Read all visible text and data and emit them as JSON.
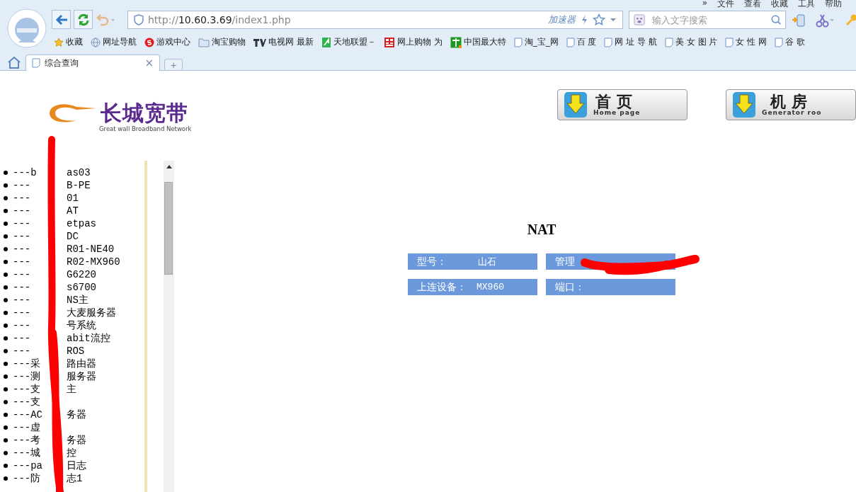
{
  "browser": {
    "menu": [
      "»",
      "文件",
      "查看",
      "收藏",
      "工具",
      "帮助"
    ],
    "url": {
      "scheme": "http://",
      "host": "10.60.3.69",
      "path": "/index1.php"
    },
    "accelerator": "加速器",
    "search": {
      "placeholder": "输入文字搜索"
    },
    "bookmarks": [
      {
        "label": "收藏",
        "kind": "star"
      },
      {
        "label": "网址导航",
        "kind": "globe"
      },
      {
        "label": "游戏中心",
        "kind": "game"
      },
      {
        "label": "淘宝购物",
        "kind": "folder"
      },
      {
        "label": "电视网 最新",
        "kind": "tv"
      },
      {
        "label": "天地联盟－",
        "kind": "green"
      },
      {
        "label": "网上购物 为",
        "kind": "red"
      },
      {
        "label": "中国最大特",
        "kind": "greenbox"
      },
      {
        "label": "淘_宝_网",
        "kind": "page"
      },
      {
        "label": "百 度",
        "kind": "page"
      },
      {
        "label": "网 址 导 航",
        "kind": "page"
      },
      {
        "label": "美 女 图 片",
        "kind": "page"
      },
      {
        "label": "女 性 网",
        "kind": "page"
      },
      {
        "label": "谷 歌",
        "kind": "page"
      }
    ],
    "tabs": [
      {
        "label": "综合查询",
        "selected": true,
        "close": "×"
      }
    ],
    "new_tab": "+"
  },
  "header": {
    "logo": {
      "name": "长城宽带",
      "tagline": "Great wall Broadband Network"
    },
    "nav": [
      {
        "title": "首页",
        "subtitle": "Home page"
      },
      {
        "title": "机房",
        "subtitle": "Generator roo"
      }
    ]
  },
  "tree": [
    {
      "head": "---b",
      "tail": "as03"
    },
    {
      "head": "---",
      "tail": "B-PE"
    },
    {
      "head": "---",
      "tail": "01"
    },
    {
      "head": "---",
      "tail": "AT"
    },
    {
      "head": "---",
      "tail": "etpas"
    },
    {
      "head": "---",
      "tail": "DC"
    },
    {
      "head": "---",
      "tail": "R01-NE40"
    },
    {
      "head": "---",
      "tail": "R02-MX960"
    },
    {
      "head": "---",
      "tail": "G6220"
    },
    {
      "head": "---",
      "tail": "s6700"
    },
    {
      "head": "---",
      "tail": "NS主"
    },
    {
      "head": "---",
      "tail": "大麦服务器"
    },
    {
      "head": "---",
      "tail": "号系统"
    },
    {
      "head": "---",
      "tail": "abit流控"
    },
    {
      "head": "---",
      "tail": "ROS"
    },
    {
      "head": "---采",
      "tail": "路由器"
    },
    {
      "head": "---测",
      "tail": "服务器"
    },
    {
      "head": "---支",
      "tail": "主"
    },
    {
      "head": "---支"
    },
    {
      "head": "---AC",
      "tail": "务器"
    },
    {
      "head": "---虚"
    },
    {
      "head": "---考",
      "tail": "务器"
    },
    {
      "head": "---城",
      "tail": "控"
    },
    {
      "head": "---pa",
      "tail": "日志"
    },
    {
      "head": "---防",
      "tail": "志1"
    }
  ],
  "detail": {
    "title": "NAT",
    "fields": [
      {
        "label": "型号：",
        "value": "山石"
      },
      {
        "label": "管理"
      },
      {
        "label": "上连设备：",
        "value": "MX960"
      },
      {
        "label": "端口："
      }
    ]
  }
}
